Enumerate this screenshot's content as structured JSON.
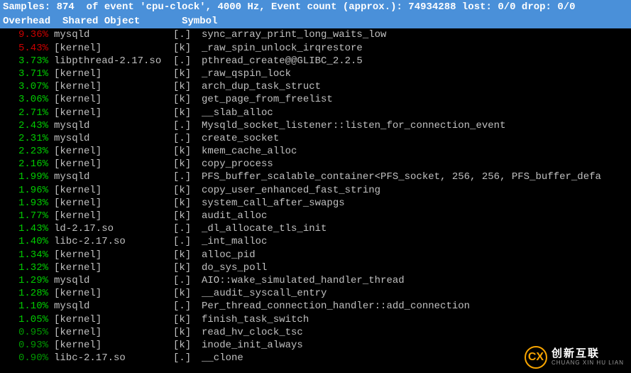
{
  "header": {
    "line1": "Samples: 874  of event 'cpu-clock', 4000 Hz, Event count (approx.): 74934288 lost: 0/0 drop: 0/0",
    "col_overhead": "Overhead",
    "col_shared": "Shared Object",
    "col_symbol": "Symbol"
  },
  "rows": [
    {
      "overhead": "9.36%",
      "color": "red",
      "obj": "mysqld",
      "kind": "[.]",
      "sym": "sync_array_print_long_waits_low"
    },
    {
      "overhead": "5.43%",
      "color": "red",
      "obj": "[kernel]",
      "kind": "[k]",
      "sym": "_raw_spin_unlock_irqrestore"
    },
    {
      "overhead": "3.73%",
      "color": "bright-green",
      "obj": "libpthread-2.17.so",
      "kind": "[.]",
      "sym": "pthread_create@@GLIBC_2.2.5"
    },
    {
      "overhead": "3.71%",
      "color": "bright-green",
      "obj": "[kernel]",
      "kind": "[k]",
      "sym": "_raw_qspin_lock"
    },
    {
      "overhead": "3.07%",
      "color": "bright-green",
      "obj": "[kernel]",
      "kind": "[k]",
      "sym": "arch_dup_task_struct"
    },
    {
      "overhead": "3.06%",
      "color": "bright-green",
      "obj": "[kernel]",
      "kind": "[k]",
      "sym": "get_page_from_freelist"
    },
    {
      "overhead": "2.71%",
      "color": "bright-green",
      "obj": "[kernel]",
      "kind": "[k]",
      "sym": "__slab_alloc"
    },
    {
      "overhead": "2.43%",
      "color": "bright-green",
      "obj": "mysqld",
      "kind": "[.]",
      "sym": "Mysqld_socket_listener::listen_for_connection_event"
    },
    {
      "overhead": "2.31%",
      "color": "bright-green",
      "obj": "mysqld",
      "kind": "[.]",
      "sym": "create_socket"
    },
    {
      "overhead": "2.23%",
      "color": "bright-green",
      "obj": "[kernel]",
      "kind": "[k]",
      "sym": "kmem_cache_alloc"
    },
    {
      "overhead": "2.16%",
      "color": "bright-green",
      "obj": "[kernel]",
      "kind": "[k]",
      "sym": "copy_process"
    },
    {
      "overhead": "1.99%",
      "color": "bright-green",
      "obj": "mysqld",
      "kind": "[.]",
      "sym": "PFS_buffer_scalable_container<PFS_socket, 256, 256, PFS_buffer_defa"
    },
    {
      "overhead": "1.96%",
      "color": "bright-green",
      "obj": "[kernel]",
      "kind": "[k]",
      "sym": "copy_user_enhanced_fast_string"
    },
    {
      "overhead": "1.93%",
      "color": "bright-green",
      "obj": "[kernel]",
      "kind": "[k]",
      "sym": "system_call_after_swapgs"
    },
    {
      "overhead": "1.77%",
      "color": "bright-green",
      "obj": "[kernel]",
      "kind": "[k]",
      "sym": "audit_alloc"
    },
    {
      "overhead": "1.43%",
      "color": "bright-green",
      "obj": "ld-2.17.so",
      "kind": "[.]",
      "sym": "_dl_allocate_tls_init"
    },
    {
      "overhead": "1.40%",
      "color": "bright-green",
      "obj": "libc-2.17.so",
      "kind": "[.]",
      "sym": "_int_malloc"
    },
    {
      "overhead": "1.34%",
      "color": "bright-green",
      "obj": "[kernel]",
      "kind": "[k]",
      "sym": "alloc_pid"
    },
    {
      "overhead": "1.32%",
      "color": "bright-green",
      "obj": "[kernel]",
      "kind": "[k]",
      "sym": "do_sys_poll"
    },
    {
      "overhead": "1.29%",
      "color": "bright-green",
      "obj": "mysqld",
      "kind": "[.]",
      "sym": "AIO::wake_simulated_handler_thread"
    },
    {
      "overhead": "1.28%",
      "color": "bright-green",
      "obj": "[kernel]",
      "kind": "[k]",
      "sym": "__audit_syscall_entry"
    },
    {
      "overhead": "1.10%",
      "color": "bright-green",
      "obj": "mysqld",
      "kind": "[.]",
      "sym": "Per_thread_connection_handler::add_connection"
    },
    {
      "overhead": "1.05%",
      "color": "bright-green",
      "obj": "[kernel]",
      "kind": "[k]",
      "sym": "finish_task_switch"
    },
    {
      "overhead": "0.95%",
      "color": "green",
      "obj": "[kernel]",
      "kind": "[k]",
      "sym": "read_hv_clock_tsc"
    },
    {
      "overhead": "0.93%",
      "color": "green",
      "obj": "[kernel]",
      "kind": "[k]",
      "sym": "inode_init_always"
    },
    {
      "overhead": "0.90%",
      "color": "green",
      "obj": "libc-2.17.so",
      "kind": "[.]",
      "sym": "__clone"
    }
  ],
  "watermark": {
    "logo": "CX",
    "main": "创新互联",
    "sub": "CHUANG XIN HU LIAN"
  }
}
